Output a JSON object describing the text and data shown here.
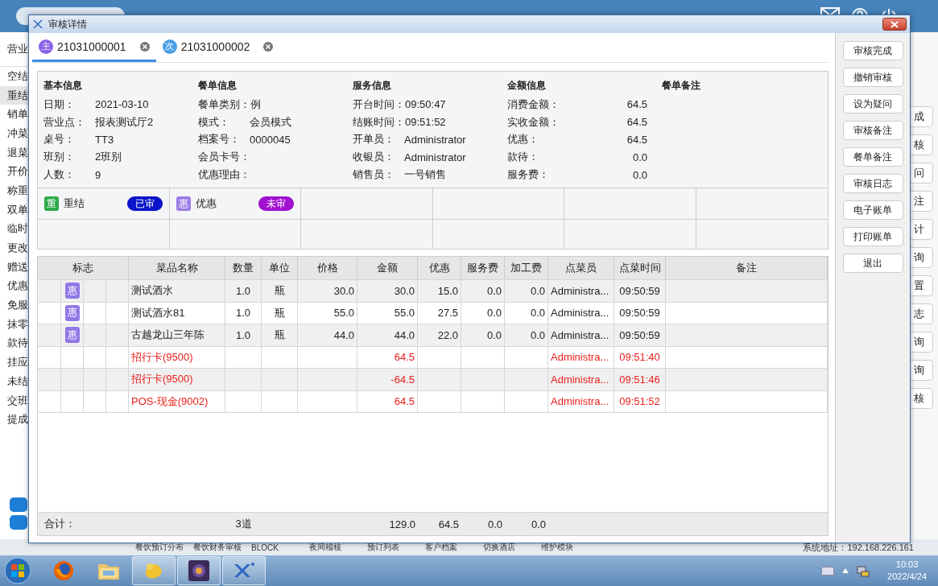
{
  "background_app": {
    "left_menu": {
      "title": "营业",
      "items": [
        {
          "label": "空结",
          "selected": false
        },
        {
          "label": "重结",
          "selected": true
        },
        {
          "label": "销单",
          "selected": false
        },
        {
          "label": "冲菜",
          "selected": false
        },
        {
          "label": "退菜",
          "selected": false
        },
        {
          "label": "开价",
          "selected": false
        },
        {
          "label": "称重",
          "selected": false
        },
        {
          "label": "双单",
          "selected": false
        },
        {
          "label": "临时",
          "selected": false
        },
        {
          "label": "更改",
          "selected": false
        },
        {
          "label": "赠送",
          "selected": false
        },
        {
          "label": "优惠",
          "selected": false
        },
        {
          "label": "免服",
          "selected": false
        },
        {
          "label": "抹零",
          "selected": false
        },
        {
          "label": "款待",
          "selected": false
        },
        {
          "label": "挂应",
          "selected": false
        },
        {
          "label": "未结",
          "selected": false
        },
        {
          "label": "交班",
          "selected": false
        },
        {
          "label": "提成",
          "selected": false
        }
      ]
    },
    "right_buttons": [
      "成",
      "核",
      "问",
      "注",
      "计",
      "询",
      "置",
      "志",
      "询",
      "询",
      "核"
    ],
    "bottom_menu": [
      "餐饮预订分布",
      "餐饮财务审核",
      "BLOCK",
      "夜间稽核",
      "预订列表",
      "客户档案",
      "切换酒店",
      "维护模块"
    ],
    "system_address": "系统地址：192.168.226.161"
  },
  "dialog": {
    "title": "审核详情",
    "tabs": [
      {
        "badge": "主",
        "label": "21031000001",
        "selected": true,
        "color": "#8a63e8"
      },
      {
        "badge": "次",
        "label": "21031000002",
        "selected": false,
        "color": "#4a9fe6"
      }
    ],
    "info_sections": [
      {
        "kind": "plain",
        "title": "基本信息",
        "fields": [
          {
            "label": "日期：",
            "value": "2021-03-10"
          },
          {
            "label": "营业点：",
            "value": "报表测试厅2"
          },
          {
            "label": "桌号：",
            "value": "TT3"
          },
          {
            "label": "班别：",
            "value": "2班别"
          },
          {
            "label": "人数：",
            "value": "9"
          }
        ]
      },
      {
        "kind": "plain",
        "title": "餐单信息",
        "fields": [
          {
            "label": "餐单类别：",
            "value": "例"
          },
          {
            "label": "模式：",
            "value": "会员模式"
          },
          {
            "label": "档案号：",
            "value": "0000045"
          },
          {
            "label": "会员卡号："
          },
          {
            "label": "优惠理由："
          }
        ]
      },
      {
        "kind": "plain",
        "title": "服务信息",
        "fields": [
          {
            "label": "开台时间：",
            "value": "09:50:47"
          },
          {
            "label": "结账时间：",
            "value": "09:51:52"
          },
          {
            "label": "开单员：",
            "value": "Administrator"
          },
          {
            "label": "收银员：",
            "value": "Administrator"
          },
          {
            "label": "销售员：",
            "value": "一号销售"
          }
        ]
      },
      {
        "kind": "amount",
        "title": "金额信息",
        "fields": [
          {
            "label": "消费金额：",
            "value": "64.5"
          },
          {
            "label": "实收金额：",
            "value": "64.5"
          },
          {
            "label": "优惠：",
            "value": "64.5"
          },
          {
            "label": "款待：",
            "value": "0.0"
          },
          {
            "label": "服务费：",
            "value": "0.0"
          }
        ]
      },
      {
        "kind": "plain",
        "title": "餐单备注"
      }
    ],
    "flags": [
      {
        "icon": "重",
        "label": "重结",
        "status": "已审",
        "color": "#2eaa4a",
        "reviewed": true
      },
      {
        "icon": "惠",
        "label": "优惠",
        "status": "未审",
        "color": "#9b7de6",
        "reviewed": false
      }
    ],
    "table": {
      "columns": [
        "标志",
        "菜品名称",
        "数量",
        "单位",
        "价格",
        "金额",
        "优惠",
        "服务费",
        "加工费",
        "点菜员",
        "点菜时间",
        "备注"
      ],
      "rows": [
        {
          "kind": "dish",
          "flag": "惠",
          "name": "测试酒水",
          "qty": "1.0",
          "unit": "瓶",
          "price": "30.0",
          "amount": "30.0",
          "discount": "15.0",
          "service": "0.0",
          "processing": "0.0",
          "waiter": "Administra...",
          "time": "09:50:59"
        },
        {
          "kind": "dish",
          "flag": "惠",
          "name": "测试酒水81",
          "qty": "1.0",
          "unit": "瓶",
          "price": "55.0",
          "amount": "55.0",
          "discount": "27.5",
          "service": "0.0",
          "processing": "0.0",
          "waiter": "Administra...",
          "time": "09:50:59"
        },
        {
          "kind": "dish",
          "flag": "惠",
          "name": "古越龙山三年陈",
          "qty": "1.0",
          "unit": "瓶",
          "price": "44.0",
          "amount": "44.0",
          "discount": "22.0",
          "service": "0.0",
          "processing": "0.0",
          "waiter": "Administra...",
          "time": "09:50:59"
        },
        {
          "kind": "payment",
          "name": "招行卡(9500)",
          "amount": "64.5",
          "waiter": "Administra...",
          "time": "09:51:40"
        },
        {
          "kind": "payment",
          "name": "招行卡(9500)",
          "amount": "-64.5",
          "waiter": "Administra...",
          "time": "09:51:46"
        },
        {
          "kind": "payment",
          "name": "POS-现金(9002)",
          "amount": "64.5",
          "waiter": "Administra...",
          "time": "09:51:52"
        }
      ],
      "totals": {
        "label": "合计：",
        "count": "3道",
        "amount": "129.0",
        "discount": "64.5",
        "service": "0.0",
        "processing": "0.0"
      }
    },
    "side_buttons": [
      "审核完成",
      "撤销审核",
      "设为疑问",
      "审核备注",
      "餐单备注",
      "审核日志",
      "电子账单",
      "打印账单",
      "退出"
    ]
  },
  "taskbar": {
    "apps": [
      {
        "kind": "browser",
        "open": false
      },
      {
        "kind": "folder",
        "open": false
      },
      {
        "kind": "blob",
        "open": true
      },
      {
        "kind": "ide",
        "open": true
      },
      {
        "kind": "xr",
        "open": true
      }
    ],
    "clock": {
      "time": "10:03",
      "date": "2022/4/24"
    }
  }
}
